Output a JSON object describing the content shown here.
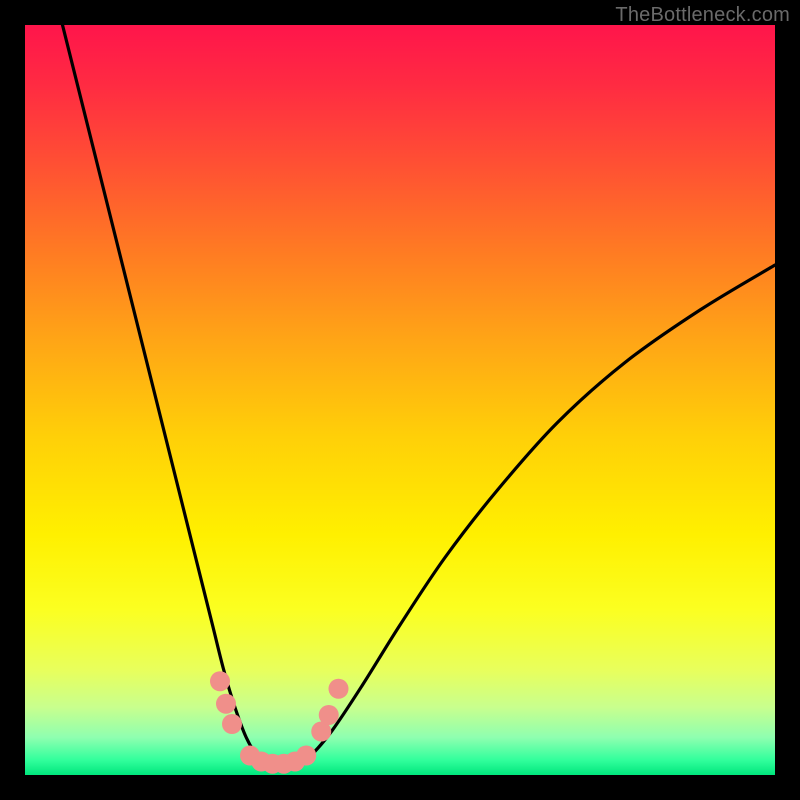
{
  "watermark": "TheBottleneck.com",
  "chart_data": {
    "type": "line",
    "title": "",
    "xlabel": "",
    "ylabel": "",
    "xlim": [
      0,
      100
    ],
    "ylim": [
      0,
      100
    ],
    "series": [
      {
        "name": "bottleneck-curve",
        "x": [
          5,
          7,
          9,
          11,
          13,
          15,
          17,
          19,
          21,
          23,
          25,
          26.5,
          28,
          29.5,
          31,
          32.5,
          34,
          36,
          38,
          41,
          45,
          50,
          56,
          63,
          71,
          80,
          90,
          100
        ],
        "y": [
          100,
          92,
          84,
          76,
          68,
          60,
          52,
          44,
          36,
          28,
          20,
          14,
          9,
          5,
          2.5,
          1.2,
          1.0,
          1.3,
          2.5,
          6,
          12,
          20,
          29,
          38,
          47,
          55,
          62,
          68
        ]
      }
    ],
    "markers": {
      "name": "highlight-dots",
      "color": "#f08f8a",
      "points": [
        {
          "x": 26.0,
          "y": 12.5
        },
        {
          "x": 26.8,
          "y": 9.5
        },
        {
          "x": 27.6,
          "y": 6.8
        },
        {
          "x": 30.0,
          "y": 2.6
        },
        {
          "x": 31.5,
          "y": 1.8
        },
        {
          "x": 33.0,
          "y": 1.5
        },
        {
          "x": 34.5,
          "y": 1.5
        },
        {
          "x": 36.0,
          "y": 1.8
        },
        {
          "x": 37.5,
          "y": 2.6
        },
        {
          "x": 39.5,
          "y": 5.8
        },
        {
          "x": 40.5,
          "y": 8.0
        },
        {
          "x": 41.8,
          "y": 11.5
        }
      ]
    }
  }
}
